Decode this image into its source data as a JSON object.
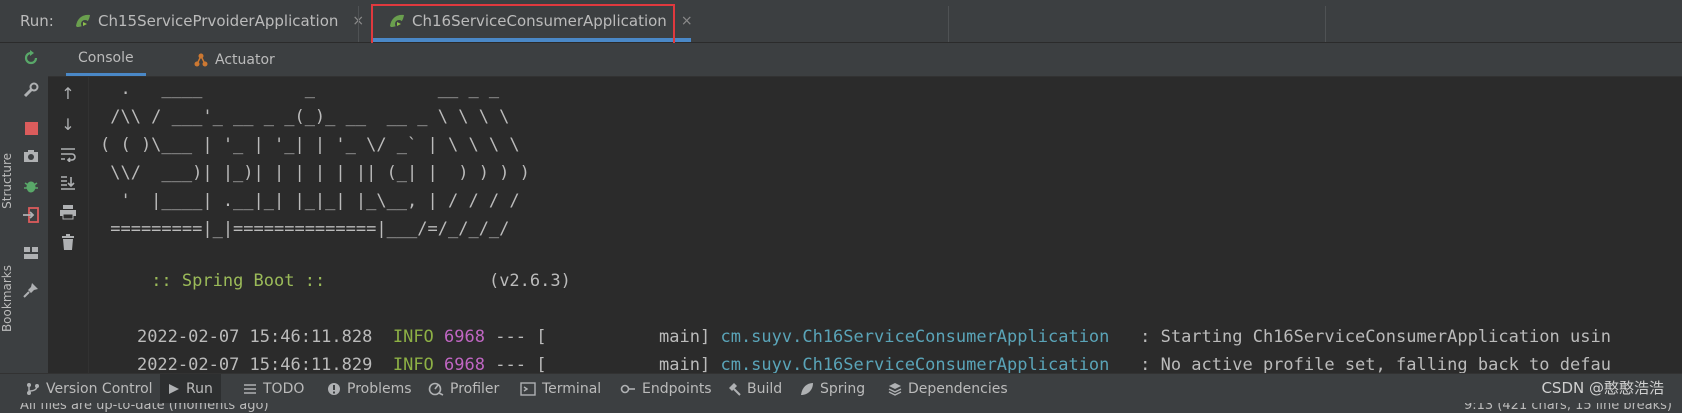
{
  "run_bar": {
    "label": "Run:",
    "tabs": [
      {
        "label": "Ch15ServicePrvoiderApplication",
        "icon": "spring-run-icon",
        "active": false
      },
      {
        "label": "Ch16ServiceConsumerApplication",
        "icon": "spring-run-icon",
        "active": true
      }
    ],
    "close_glyph": "×"
  },
  "left_strip": {
    "structure": "Structure",
    "bookmarks": "Bookmarks"
  },
  "console_tabs": {
    "console": "Console",
    "actuator": "Actuator"
  },
  "console": {
    "banner": [
      "  .   ____          _            __ _ _",
      " /\\\\ / ___'_ __ _ _(_)_ __  __ _ \\ \\ \\ \\",
      "( ( )\\___ | '_ | '_| | '_ \\/ _` | \\ \\ \\ \\",
      " \\\\/  ___)| |_)| | | | | || (_| |  ) ) ) )",
      "  '  |____| .__|_| |_|_| |_\\__, | / / / /",
      " =========|_|==============|___/=/_/_/_/"
    ],
    "spring_boot_label": " :: Spring Boot ::",
    "spring_boot_version": "(v2.6.3)",
    "logs": [
      {
        "timestamp": "2022-02-07 15:46:11.828",
        "level": "INFO",
        "pid": "6968",
        "sep": "--- [",
        "thread": "main]",
        "logger": "cm.suyv.Ch16ServiceConsumerApplication",
        "message": ": Starting Ch16ServiceConsumerApplication usin"
      },
      {
        "timestamp": "2022-02-07 15:46:11.829",
        "level": "INFO",
        "pid": "6968",
        "sep": "--- [",
        "thread": "main]",
        "logger": "cm.suyv.Ch16ServiceConsumerApplication",
        "message": ": No active profile set, falling back to defau"
      }
    ]
  },
  "bottom_bar": {
    "items": [
      "Version Control",
      "Run",
      "TODO",
      "Problems",
      "Profiler",
      "Terminal",
      "Endpoints",
      "Build",
      "Spring",
      "Dependencies"
    ],
    "watermark": "CSDN @憨憨浩浩"
  },
  "status_bar": {
    "left": "All files are up-to-date (moments ago)",
    "right": "9:13 (421 chars, 15 line breaks)"
  },
  "colors": {
    "accent_blue": "#4a88c7",
    "highlight_red": "#e0393e",
    "info_green": "#8db045",
    "pid_purple": "#c066c3",
    "logger_cyan": "#5aa4b8",
    "spring_green": "#9bbb59"
  }
}
